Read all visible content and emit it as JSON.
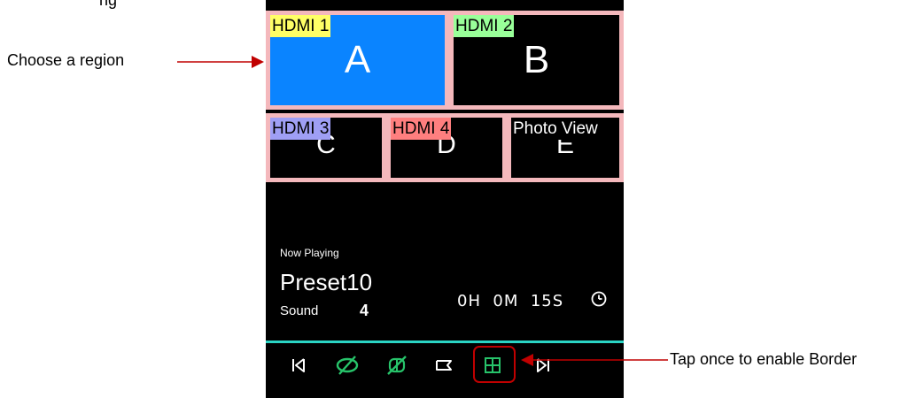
{
  "annotations": {
    "top_left_fragment": "ng",
    "choose_region": "Choose a region",
    "tap_border": "Tap once to enable Border",
    "colors": {
      "arrow": "#c00000",
      "highlight_box": "#c00000"
    }
  },
  "regions": [
    {
      "letter": "A",
      "tag": "HDMI 1",
      "tag_color": "#ffff66",
      "selected": true
    },
    {
      "letter": "B",
      "tag": "HDMI 2",
      "tag_color": "#99ff99",
      "selected": false
    },
    {
      "letter": "C",
      "tag": "HDMI 3",
      "tag_color": "#9f9ff5",
      "selected": false
    },
    {
      "letter": "D",
      "tag": "HDMI 4",
      "tag_color": "#ff7f7f",
      "selected": false
    },
    {
      "letter": "E",
      "tag": "Photo View",
      "tag_color": "#000000",
      "tag_text_color": "#ffffff",
      "selected": false
    }
  ],
  "now_playing": {
    "label": "Now Playing",
    "preset": "Preset10",
    "sound_label": "Sound",
    "sound_value": "4",
    "timer": "0H  0M  15S",
    "timer_icon": "clock-icon"
  },
  "controls": [
    {
      "name": "previous-icon",
      "active": false
    },
    {
      "name": "hide-icon",
      "active": false
    },
    {
      "name": "hide-all-icon",
      "active": false
    },
    {
      "name": "label-icon",
      "active": false
    },
    {
      "name": "border-grid-icon",
      "active": true
    },
    {
      "name": "next-icon",
      "active": false
    }
  ],
  "colors": {
    "selected_region": "#0a84ff",
    "region_border": "#f4b8bc",
    "accent_line": "#2ad4c4",
    "control_green": "#27c36a",
    "control_white": "#ffffff"
  }
}
